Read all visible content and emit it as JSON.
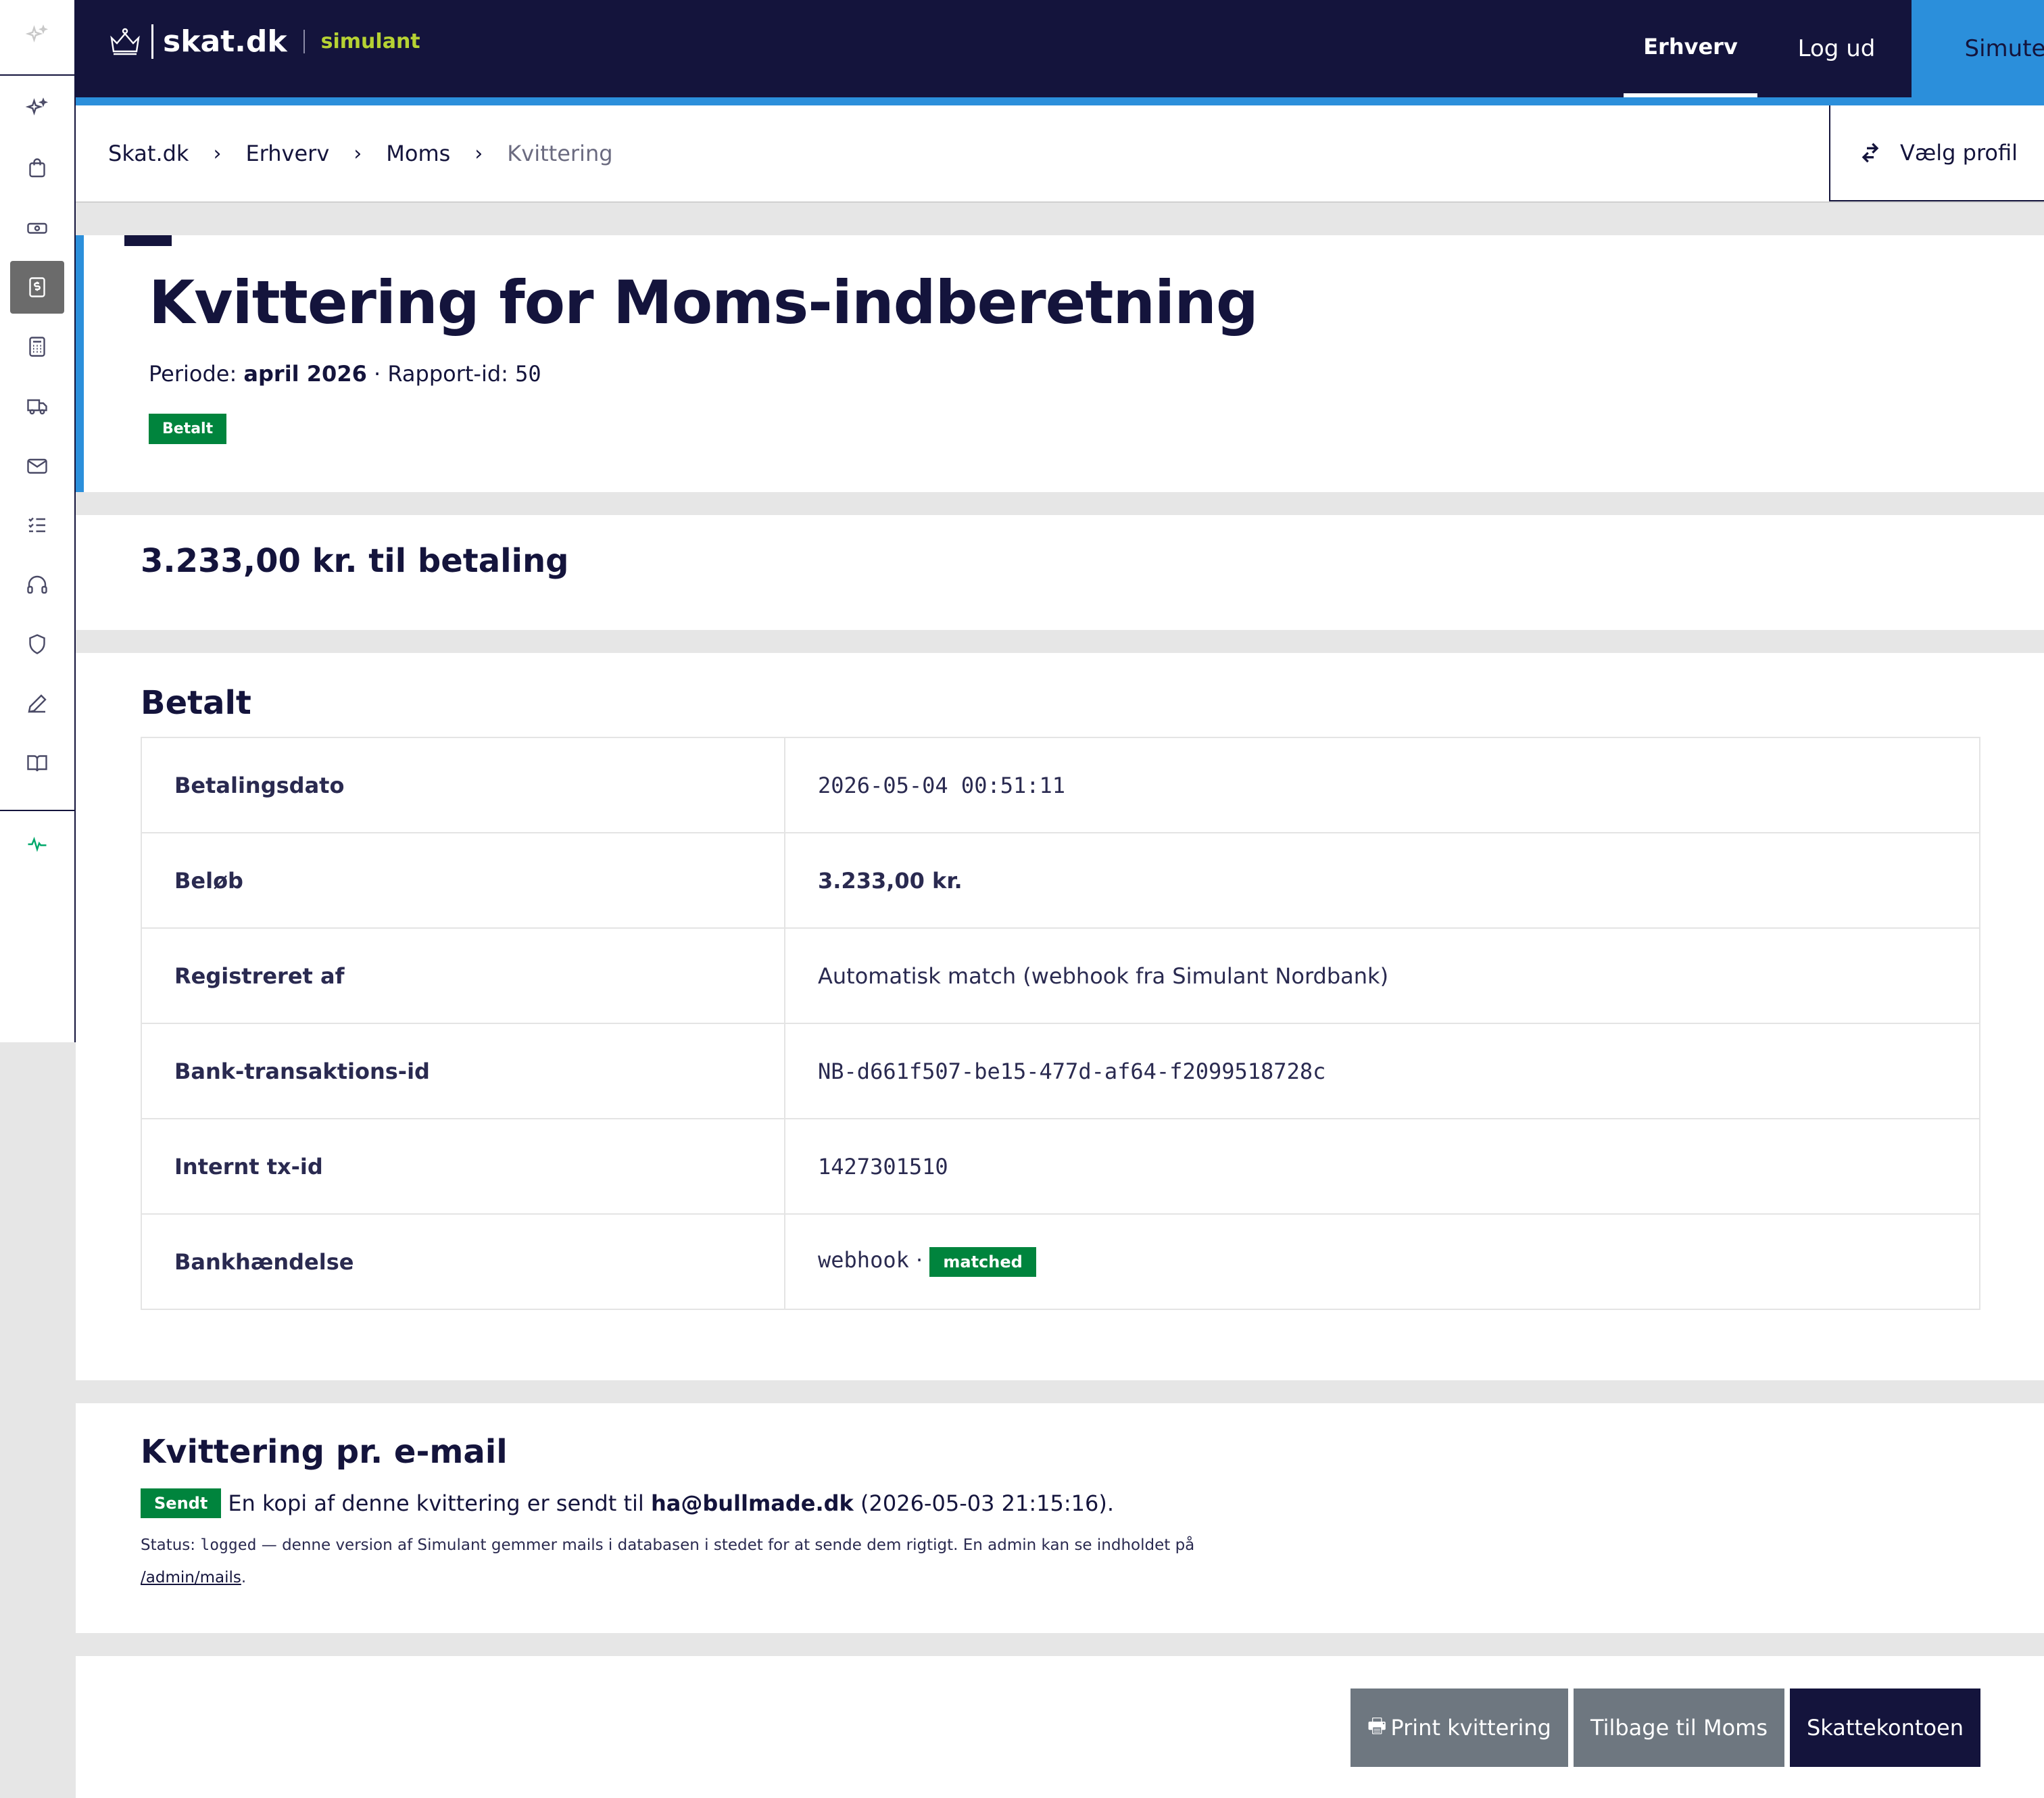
{
  "brand": {
    "name": "skat.dk",
    "sub": "simulant"
  },
  "nav": {
    "erhverv": "Erhverv",
    "logud": "Log ud",
    "simutest": "Simutest"
  },
  "breadcrumb": {
    "items": [
      "Skat.dk",
      "Erhverv",
      "Moms"
    ],
    "current": "Kvittering"
  },
  "profile": {
    "label": "Vælg profil"
  },
  "header": {
    "title": "Kvittering for Moms-indberetning",
    "period_label": "Periode:",
    "period_value": "april 2026",
    "report_label": "· Rapport-id:",
    "report_id": "50",
    "status_badge": "Betalt"
  },
  "amount": {
    "text": "3.233,00 kr. til betaling"
  },
  "paid": {
    "heading": "Betalt",
    "rows": [
      {
        "key": "Betalingsdato",
        "value": "2026-05-04 00:51:11"
      },
      {
        "key": "Beløb",
        "value": "3.233,00 kr."
      },
      {
        "key": "Registreret af",
        "value": "Automatisk match (webhook fra Simulant Nordbank)"
      },
      {
        "key": "Bank-transaktions-id",
        "value": "NB-d661f507-be15-477d-af64-f2099518728c"
      },
      {
        "key": "Internt tx-id",
        "value": "1427301510"
      },
      {
        "key": "Bankhændelse",
        "value": "webhook",
        "sep": "·",
        "badge": "matched"
      }
    ]
  },
  "mail": {
    "heading": "Kvittering pr. e-mail",
    "badge": "Sendt",
    "text_before": "En kopi af denne kvittering er sendt til",
    "email": "ha@bullmade.dk",
    "sent_at": "(2026-05-03 21:15:16).",
    "status_prefix": "Status:",
    "status_value": "logged",
    "status_text": "— denne version af Simulant gemmer mails i databasen i stedet for at sende dem rigtigt. En admin kan se indholdet på",
    "admin_link": "/admin/mails",
    "period_end": "."
  },
  "actions": {
    "print": "Print kvittering",
    "back": "Tilbage til Moms",
    "tax_account": "Skattekontoen"
  },
  "colors": {
    "navy": "#14143c",
    "blue": "#2b8fdb",
    "green": "#00843d",
    "lime": "#b6d233",
    "gray_button": "#6e7780"
  },
  "icons": {
    "rail": [
      "sparkle-icon",
      "sparkle-icon",
      "shopping-bag-icon",
      "cash-icon",
      "dollar-document-icon",
      "calculator-icon",
      "truck-icon",
      "mail-icon",
      "checklist-icon",
      "headset-icon",
      "shield-icon",
      "pen-icon",
      "book-icon",
      "activity-icon"
    ],
    "profile": "swap-arrows-icon",
    "print": "printer-icon",
    "logo": "crown-icon"
  }
}
